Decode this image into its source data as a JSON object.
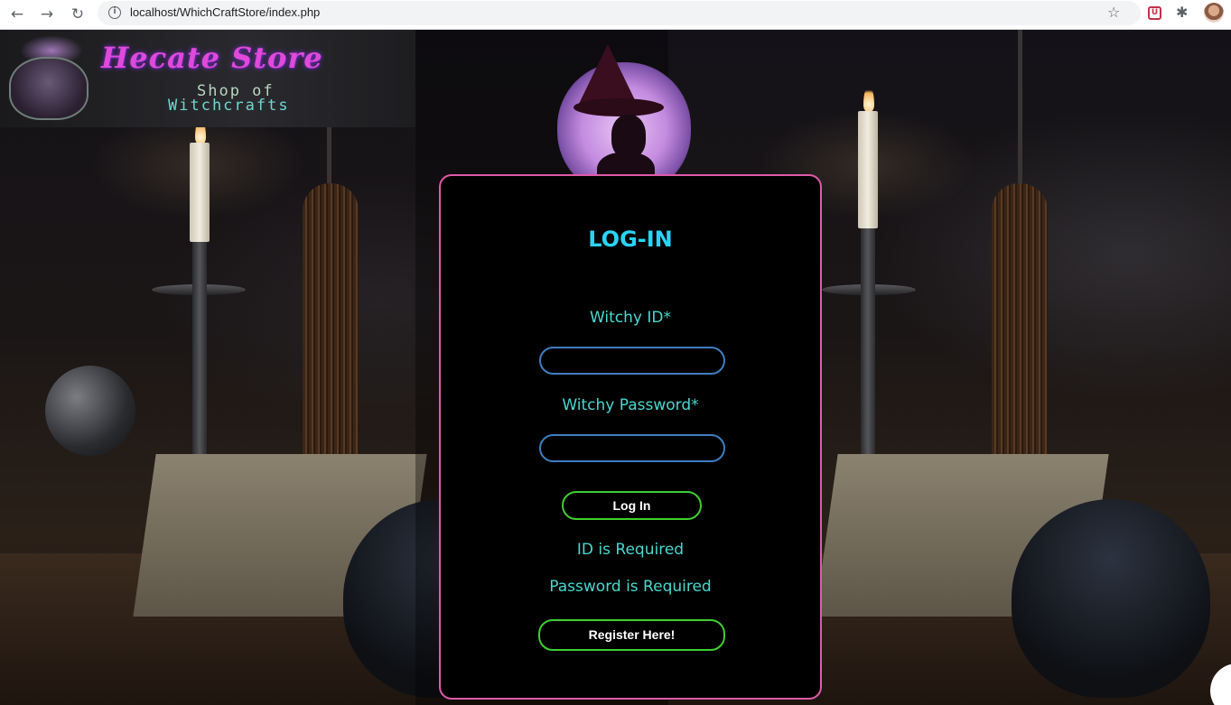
{
  "browser": {
    "url": "localhost/WhichCraftStore/index.php",
    "nav_back_icon": "←",
    "nav_forward_icon": "→",
    "nav_reload_icon": "↻",
    "info_icon": "i",
    "star_icon": "☆",
    "extension_icon": "✱"
  },
  "logo": {
    "title": "Hecate Store",
    "subtitle_line1": "Shop of",
    "subtitle_line2": "Witchcrafts"
  },
  "login": {
    "title": "LOG-IN",
    "id_label": "Witchy ID*",
    "password_label": "Witchy Password*",
    "id_value": "",
    "password_value": "",
    "login_button": "Log In",
    "error_id": "ID is Required",
    "error_password": "Password is Required",
    "register_button": "Register Here!"
  },
  "colors": {
    "card_border": "#e05aa8",
    "title": "#29d4f5",
    "label_text": "#4ad8d0",
    "input_border": "#3d7ec0",
    "button_border": "#3fcf2f"
  }
}
